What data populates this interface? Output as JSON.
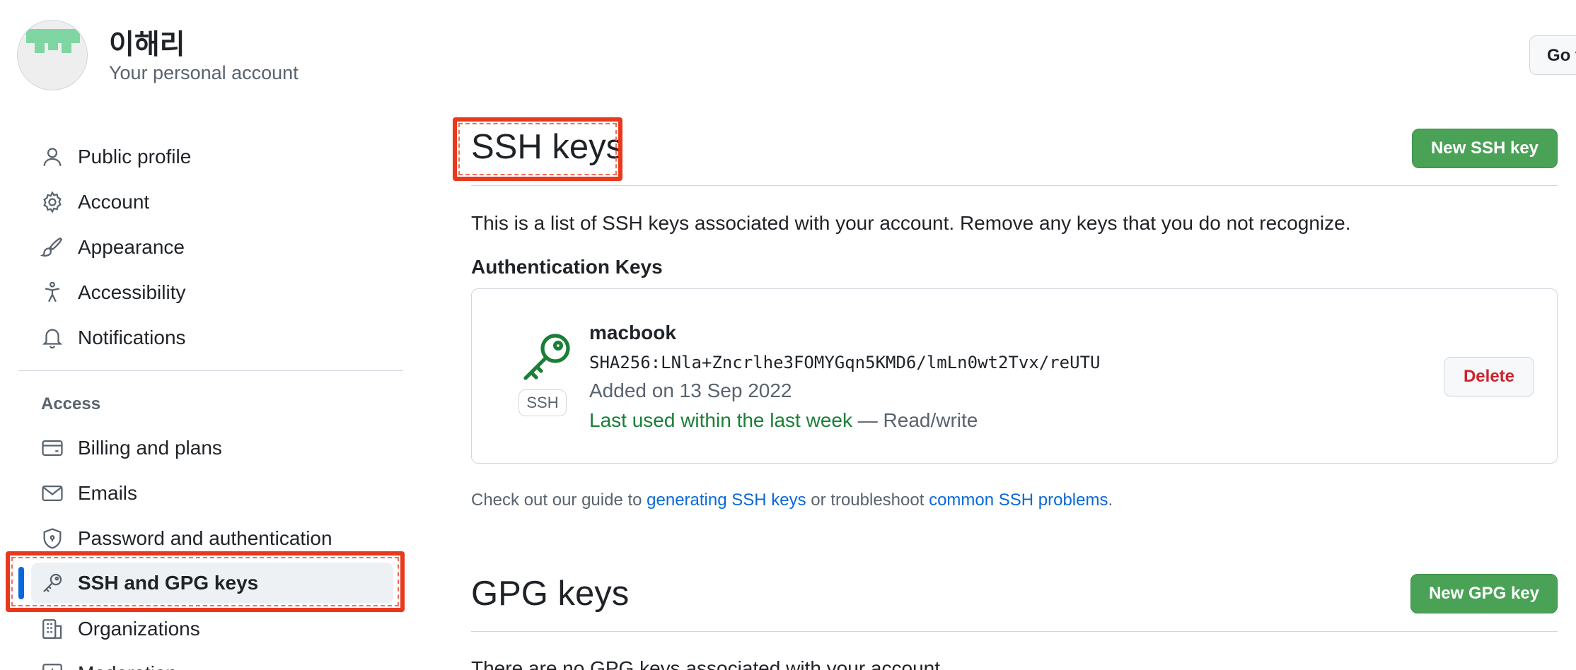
{
  "header": {
    "user_name": "이해리",
    "account_type": "Your personal account",
    "go_button": "Go t"
  },
  "sidebar": {
    "items": [
      {
        "label": "Public profile",
        "icon": "person-icon"
      },
      {
        "label": "Account",
        "icon": "gear-icon"
      },
      {
        "label": "Appearance",
        "icon": "paintbrush-icon"
      },
      {
        "label": "Accessibility",
        "icon": "accessibility-icon"
      },
      {
        "label": "Notifications",
        "icon": "bell-icon"
      }
    ],
    "access_heading": "Access",
    "access_items": [
      {
        "label": "Billing and plans",
        "icon": "credit-card-icon"
      },
      {
        "label": "Emails",
        "icon": "mail-icon"
      },
      {
        "label": "Password and authentication",
        "icon": "shield-lock-icon"
      },
      {
        "label": "SSH and GPG keys",
        "icon": "key-icon",
        "selected": true
      },
      {
        "label": "Organizations",
        "icon": "organization-icon"
      },
      {
        "label": "Moderation",
        "icon": "report-icon"
      }
    ]
  },
  "ssh": {
    "title": "SSH keys",
    "new_button": "New SSH key",
    "intro": "This is a list of SSH keys associated with your account. Remove any keys that you do not recognize.",
    "auth_heading": "Authentication Keys",
    "keys": [
      {
        "title": "macbook",
        "fingerprint": "SHA256:LNla+Zncrlhe3FOMYGqn5KMD6/lmLn0wt2Tvx/reUTU",
        "added": "Added on 13 Sep 2022",
        "last_used": "Last used within the last week",
        "access": " — Read/write",
        "badge": "SSH",
        "delete_label": "Delete"
      }
    ],
    "guide": {
      "prefix": "Check out our guide to ",
      "link1": "generating SSH keys",
      "middle": " or troubleshoot ",
      "link2": "common SSH problems",
      "suffix": "."
    }
  },
  "gpg": {
    "title": "GPG keys",
    "new_button": "New GPG key",
    "empty_text": "There are no GPG keys associated with your account."
  },
  "colors": {
    "primary_button": "#4aa256",
    "link": "#0969da",
    "danger": "#cf222e",
    "selected_indicator": "#0969da",
    "annotation": "#e8391d"
  }
}
